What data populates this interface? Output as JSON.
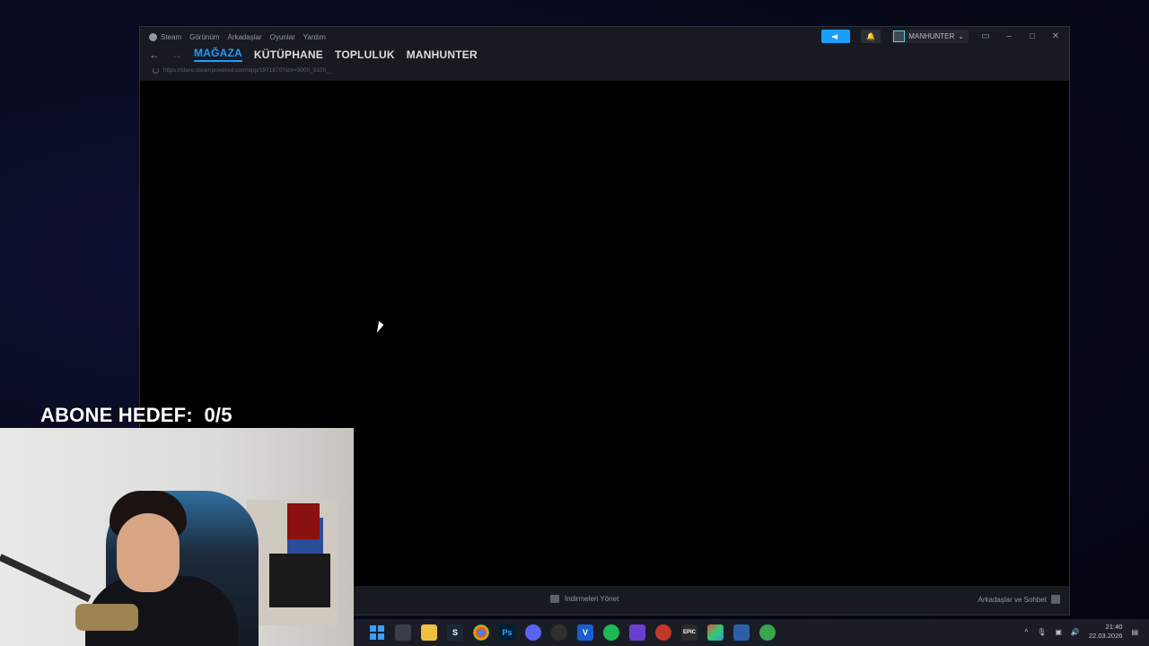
{
  "steam": {
    "menu": [
      "Steam",
      "Görünüm",
      "Arkadaşlar",
      "Oyunlar",
      "Yardım"
    ],
    "tabs": [
      "MAĞAZA",
      "KÜTÜPHANE",
      "TOPLULUK",
      "MANHUNTER"
    ],
    "url": "https://store.steampowered.com/app/1971870?snr=5000_5100__",
    "username": "MANHUNTER",
    "downloads_label": "İndirmeleri Yönet",
    "friends_label": "Arkadaşlar ve Sohbet",
    "accent_color": "#1a9fff"
  },
  "overlay": {
    "goal_label": "ABONE HEDEF:",
    "goal_value": "0/5"
  },
  "taskbar": {
    "apps": [
      "windows-start",
      "task-view",
      "file-explorer",
      "steam",
      "chrome",
      "photoshop",
      "discord",
      "obs",
      "v-app",
      "spotify",
      "grid-app",
      "app",
      "epic-games",
      "gallery",
      "monitor",
      "xbox"
    ],
    "time": "21:40",
    "date": "22.03.2026"
  }
}
